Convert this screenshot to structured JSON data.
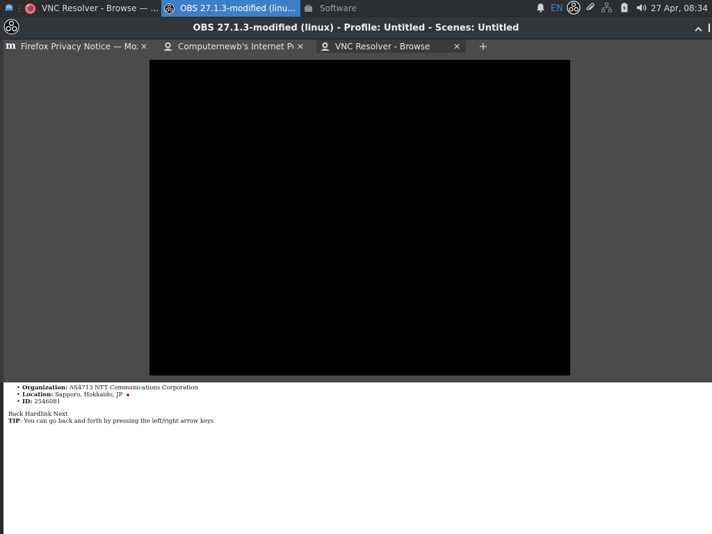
{
  "taskbar": {
    "tasks": [
      {
        "label": "VNC Resolver - Browse — M...",
        "icon": "firefox-icon",
        "active": false
      },
      {
        "label": "OBS 27.1.3-modified (linux) -...",
        "icon": "obs-icon",
        "active": true
      },
      {
        "label": "Software",
        "icon": "software-icon",
        "active": false
      }
    ],
    "keyboard_layout": "EN",
    "clock": "27 Apr, 08:34"
  },
  "window": {
    "title": "OBS 27.1.3-modified (linux) - Profile: Untitled - Scenes: Untitled"
  },
  "browser_tabs": [
    {
      "label": "Firefox Privacy Notice — Moz",
      "icon": "mozilla-m-icon",
      "active": false
    },
    {
      "label": "Computernewb's Internet Pu",
      "icon": "vnc-icon",
      "active": false
    },
    {
      "label": "VNC Resolver - Browse",
      "icon": "vnc-icon",
      "active": true
    }
  ],
  "page": {
    "details": [
      {
        "key": "Organization:",
        "value": "AS4713 NTT Communications Corporation"
      },
      {
        "key": "Location:",
        "value": "Sapporo, Hokkaido, JP"
      },
      {
        "key": "ID:",
        "value": "2546081"
      }
    ],
    "nav": "Back Hardlink Next",
    "tip_label": "TIP",
    "tip_text": ": You can go back and forth by pressing the left/right arrow keys"
  },
  "colors": {
    "taskbar_bg": "#2a2e32",
    "active_task": "#3d7fc7",
    "titlebar_bg": "#31363b",
    "preview_bg": "#4b4b4b",
    "flag_red": "#d01020"
  }
}
